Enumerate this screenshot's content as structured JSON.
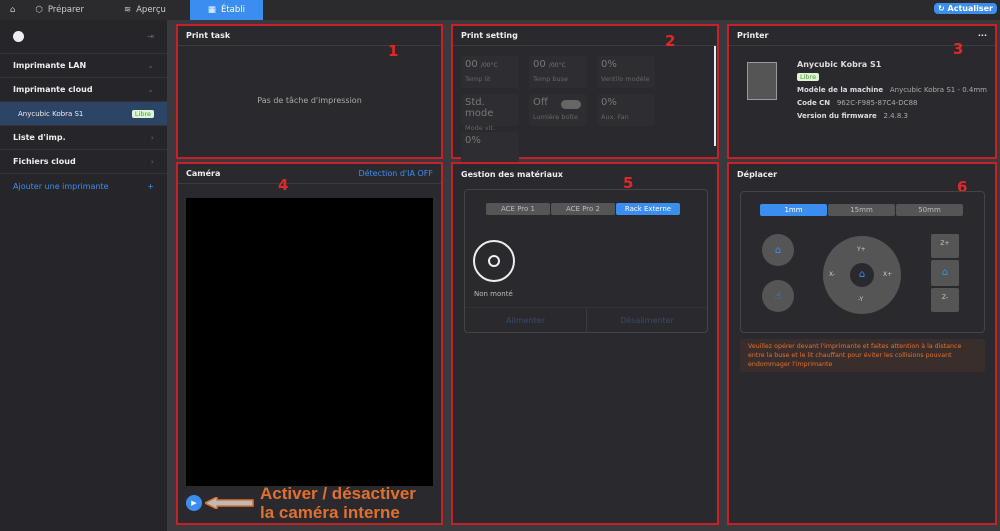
{
  "topbar": {
    "tabs": [
      {
        "label": "Préparer",
        "icon": "cube-icon"
      },
      {
        "label": "Aperçu",
        "icon": "layers-icon"
      },
      {
        "label": "Établi",
        "icon": "grid-icon"
      }
    ],
    "refresh": "Actualiser"
  },
  "sidebar": {
    "items": [
      "Imprimante LAN",
      "Imprimante cloud",
      "Liste d'imp.",
      "Fichiers cloud"
    ],
    "printer": "Anycubic Kobra S1",
    "printer_status": "Libre",
    "add": "Ajouter une imprimante"
  },
  "panel1": {
    "title": "Print task",
    "empty": "Pas de tâche d'impression",
    "num": "1"
  },
  "panel2": {
    "title": "Print setting",
    "num": "2",
    "cells": [
      {
        "value": "00",
        "unit": "/00°C",
        "label": "Temp lit"
      },
      {
        "value": "00",
        "unit": "/00°C",
        "label": "Temp buse"
      },
      {
        "value": "0%",
        "unit": "",
        "label": "Ventilo modèle"
      },
      {
        "value": "Std. mode",
        "unit": "",
        "label": "Mode vit."
      },
      {
        "value": "Off",
        "unit": "",
        "label": "Lumière boîte"
      },
      {
        "value": "0%",
        "unit": "",
        "label": "Aux. Fan"
      },
      {
        "value": "0%",
        "unit": "",
        "label": ""
      }
    ]
  },
  "panel3": {
    "title": "Printer",
    "num": "3",
    "name": "Anycubic Kobra S1",
    "status": "Libre",
    "model_label": "Modèle de la machine",
    "model": "Anycubic Kobra S1 - 0.4mm",
    "cn_label": "Code CN",
    "cn": "962C-F985-87C4-DC88",
    "fw_label": "Version du firmware",
    "fw": "2.4.8.3"
  },
  "panel4": {
    "title": "Caméra",
    "ai": "Détection d'IA OFF",
    "num": "4",
    "annotation1": "Activer / désactiver",
    "annotation2": "la caméra interne"
  },
  "panel5": {
    "title": "Gestion des matériaux",
    "num": "5",
    "tabs": [
      "ACE Pro 1",
      "ACE Pro 2",
      "Rack Externe"
    ],
    "active_tab": 2,
    "slot": "Non monté",
    "load": "Alimenter",
    "unload": "Désalimenter"
  },
  "panel6": {
    "title": "Déplacer",
    "num": "6",
    "steps": [
      "1mm",
      "15mm",
      "50mm"
    ],
    "active_step": 0,
    "yp": "Y+",
    "ym": "-Y",
    "xm": "X-",
    "xp": "X+",
    "zp": "Z+",
    "zm": "Z-",
    "warning": "Veuillez opérer devant l'imprimante et faites attention à la distance entre la buse et le lit chauffant pour éviter les collisions pouvant endommager l'imprimante"
  },
  "colors": {
    "accent": "#3b8ef0",
    "annotation": "#c82028",
    "warning": "#e07030"
  }
}
